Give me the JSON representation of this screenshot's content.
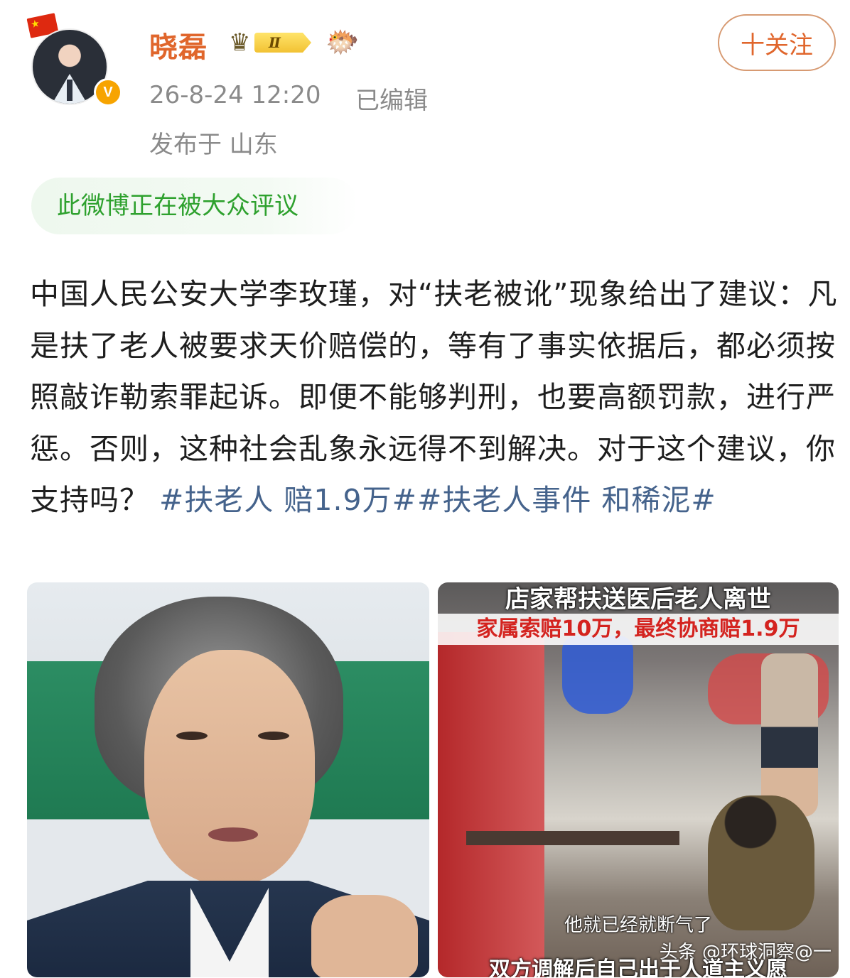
{
  "author": {
    "name": "晓磊",
    "level_badge": "Ⅱ",
    "verified_mark": "V"
  },
  "post_meta": {
    "timestamp": "26-8-24 12:20",
    "edited": "已编辑",
    "location": "发布于 山东"
  },
  "follow_button": {
    "label": "十关注"
  },
  "discussion_banner": "此微博正在被大众评议",
  "post": {
    "body": "中国人民公安大学李玫瑾，对“扶老被讹”现象给出了建议：凡是扶了老人被要求天价赔偿的，等有了事实依据后，都必须按照敲诈勒索罪起诉。即便不能够判刑，也要高额罚款，进行严惩。否则，这种社会乱象永远得不到解决。对于这个建议，你支持吗？ ",
    "tags": "#扶老人 赔1.9万##扶老人事件 和稀泥#"
  },
  "images": {
    "right": {
      "caption_top": "店家帮扶送医后老人离世",
      "caption_red": "家属索赔10万，最终协商赔1.9万",
      "subtitle_1": "他就已经就断气了",
      "watermark": "头条 @环球洞察@一",
      "subtitle_2": "双方调解后自己出于人道主义愿"
    }
  },
  "colors": {
    "username": "#e0662c",
    "meta_gray": "#8a8a8a",
    "banner_green": "#2ea12e",
    "hashtag": "#45638c"
  },
  "icons": [
    "flag-icon",
    "verified-icon",
    "crown-icon",
    "fish-icon"
  ]
}
